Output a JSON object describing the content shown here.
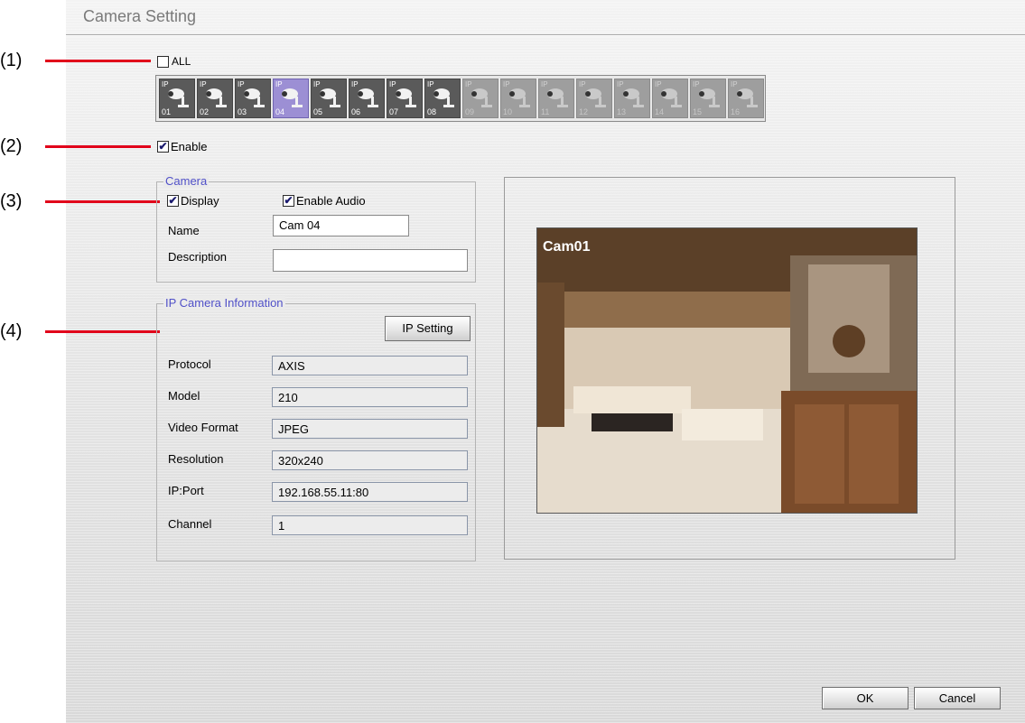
{
  "window": {
    "title": "Camera Setting"
  },
  "callouts": [
    "(1)",
    "(2)",
    "(3)",
    "(4)"
  ],
  "all_checkbox": {
    "label": "ALL",
    "checked": false
  },
  "camera_strip": [
    {
      "num": "01",
      "badge": "IP",
      "state": "on"
    },
    {
      "num": "02",
      "badge": "IP",
      "state": "on"
    },
    {
      "num": "03",
      "badge": "IP",
      "state": "on"
    },
    {
      "num": "04",
      "badge": "IP",
      "state": "selected"
    },
    {
      "num": "05",
      "badge": "IP",
      "state": "on"
    },
    {
      "num": "06",
      "badge": "IP",
      "state": "on"
    },
    {
      "num": "07",
      "badge": "IP",
      "state": "on"
    },
    {
      "num": "08",
      "badge": "IP",
      "state": "on"
    },
    {
      "num": "09",
      "badge": "IP",
      "state": "off"
    },
    {
      "num": "10",
      "badge": "IP",
      "state": "off"
    },
    {
      "num": "11",
      "badge": "IP",
      "state": "off"
    },
    {
      "num": "12",
      "badge": "IP",
      "state": "off"
    },
    {
      "num": "13",
      "badge": "IP",
      "state": "off"
    },
    {
      "num": "14",
      "badge": "IP",
      "state": "off"
    },
    {
      "num": "15",
      "badge": "IP",
      "state": "off"
    },
    {
      "num": "16",
      "badge": "IP",
      "state": "off"
    }
  ],
  "enable": {
    "label": "Enable",
    "checked": true
  },
  "camera_group": {
    "title": "Camera",
    "display": {
      "label": "Display",
      "checked": true
    },
    "enable_audio": {
      "label": "Enable Audio",
      "checked": true
    },
    "name_label": "Name",
    "name_value": "Cam 04",
    "description_label": "Description",
    "description_value": ""
  },
  "ip_group": {
    "title": "IP Camera Information",
    "ip_setting_button": "IP Setting",
    "rows": [
      {
        "label": "Protocol",
        "value": "AXIS"
      },
      {
        "label": "Model",
        "value": "210"
      },
      {
        "label": "Video Format",
        "value": "JPEG"
      },
      {
        "label": "Resolution",
        "value": "320x240"
      },
      {
        "label": "IP:Port",
        "value": "192.168.55.11:80"
      },
      {
        "label": "Channel",
        "value": "1"
      }
    ]
  },
  "preview": {
    "camera_label": "Cam01"
  },
  "buttons": {
    "ok": "OK",
    "cancel": "Cancel"
  },
  "colors": {
    "callout_line": "#e1001a",
    "group_title": "#5050c8",
    "selected_tile": "#9c8fd4"
  }
}
